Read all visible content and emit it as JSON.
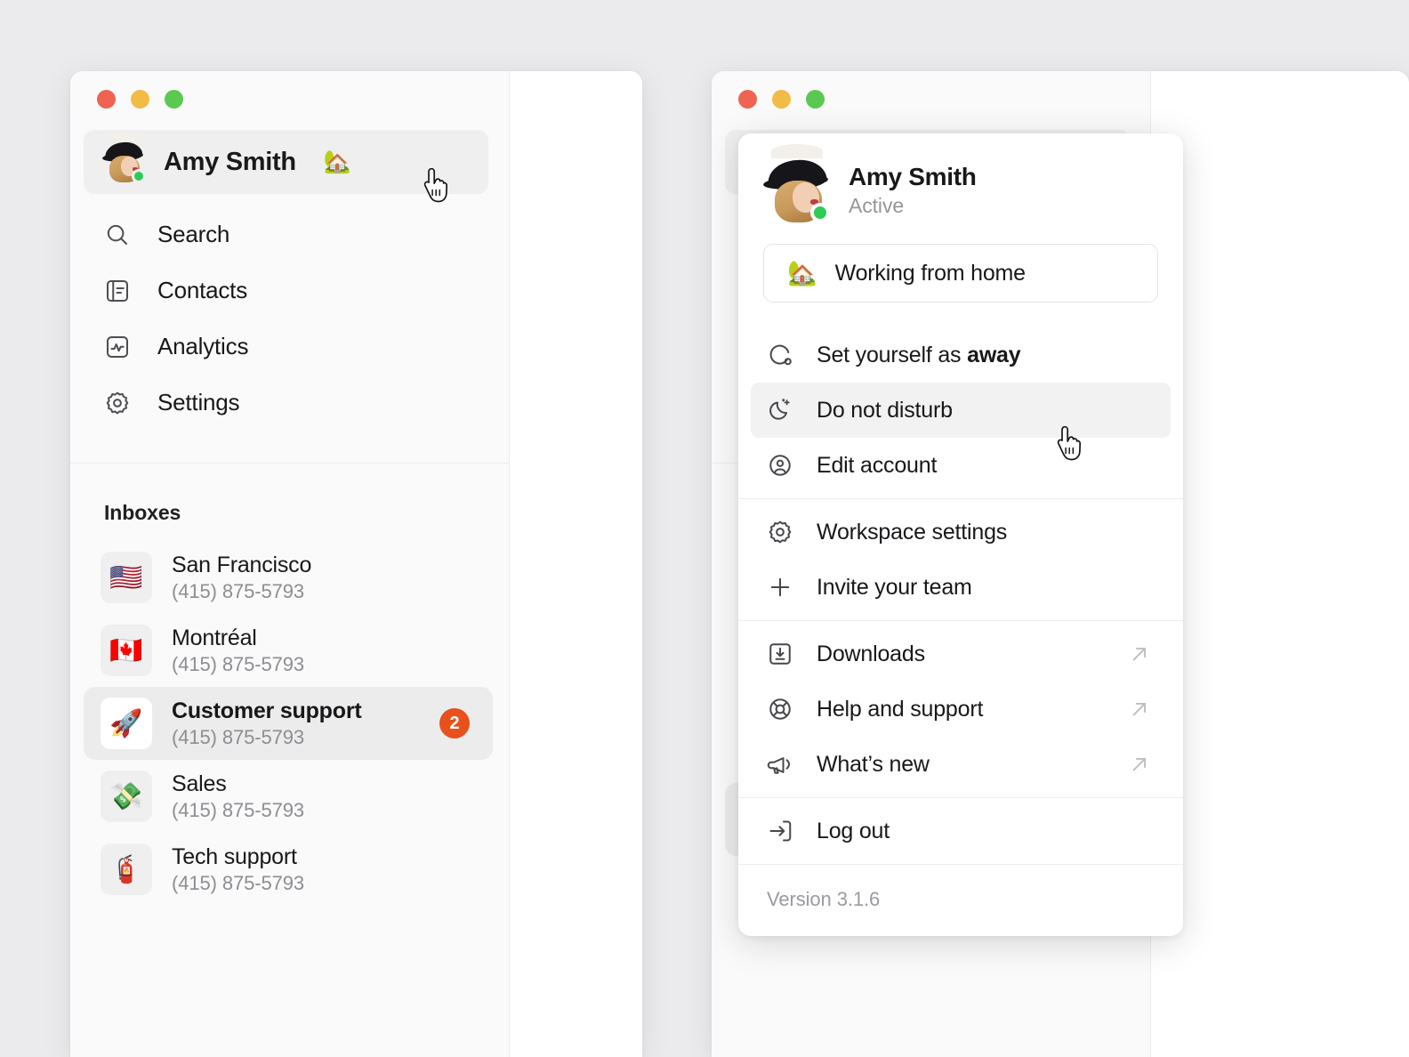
{
  "background_color": "#ebebed",
  "accent_color": "#e8501c",
  "status_online_color": "#2fcc55",
  "window_controls": {
    "close": "close-traffic-light",
    "minimize": "minimize-traffic-light",
    "maximize": "maximize-traffic-light"
  },
  "sidebar": {
    "profile": {
      "name": "Amy Smith",
      "status_emoji": "🏡"
    },
    "nav_items": [
      {
        "label": "Search",
        "icon": "search-icon"
      },
      {
        "label": "Contacts",
        "icon": "contacts-icon"
      },
      {
        "label": "Analytics",
        "icon": "analytics-icon"
      },
      {
        "label": "Settings",
        "icon": "settings-icon"
      }
    ],
    "inboxes_heading": "Inboxes",
    "inboxes": [
      {
        "emoji": "🇺🇸",
        "name": "San Francisco",
        "phone": "(415) 875-5793",
        "badge": "",
        "selected": false
      },
      {
        "emoji": "🇨🇦",
        "name": "Montréal",
        "phone": "(415) 875-5793",
        "badge": "",
        "selected": false
      },
      {
        "emoji": "🚀",
        "name": "Customer support",
        "phone": "(415) 875-5793",
        "badge": "2",
        "selected": true
      },
      {
        "emoji": "💸",
        "name": "Sales",
        "phone": "(415) 875-5793",
        "badge": "",
        "selected": false
      },
      {
        "emoji": "🧯",
        "name": "Tech support",
        "phone": "(415) 875-5793",
        "badge": "",
        "selected": false
      }
    ]
  },
  "menu": {
    "user": {
      "name": "Amy Smith",
      "status": "Active"
    },
    "status_field": {
      "emoji": "🏡",
      "text": "Working from home"
    },
    "group_status": [
      {
        "label_prefix": "Set yourself as ",
        "label_strong": "away",
        "icon": "away-circle-icon",
        "active": false,
        "external": false
      },
      {
        "label_prefix": "Do not disturb",
        "label_strong": "",
        "icon": "moon-icon",
        "active": true,
        "external": false
      },
      {
        "label_prefix": "Edit account",
        "label_strong": "",
        "icon": "account-icon",
        "active": false,
        "external": false
      }
    ],
    "group_workspace": [
      {
        "label_prefix": "Workspace settings",
        "label_strong": "",
        "icon": "gear-icon",
        "active": false,
        "external": false
      },
      {
        "label_prefix": "Invite your team",
        "label_strong": "",
        "icon": "plus-icon",
        "active": false,
        "external": false
      }
    ],
    "group_resources": [
      {
        "label_prefix": "Downloads",
        "label_strong": "",
        "icon": "download-icon",
        "active": false,
        "external": true
      },
      {
        "label_prefix": "Help and support",
        "label_strong": "",
        "icon": "lifebuoy-icon",
        "active": false,
        "external": true
      },
      {
        "label_prefix": "What’s new",
        "label_strong": "",
        "icon": "megaphone-icon",
        "active": false,
        "external": true
      }
    ],
    "group_session": [
      {
        "label_prefix": "Log out",
        "label_strong": "",
        "icon": "logout-icon",
        "active": false,
        "external": false
      }
    ],
    "version": "Version 3.1.6"
  }
}
